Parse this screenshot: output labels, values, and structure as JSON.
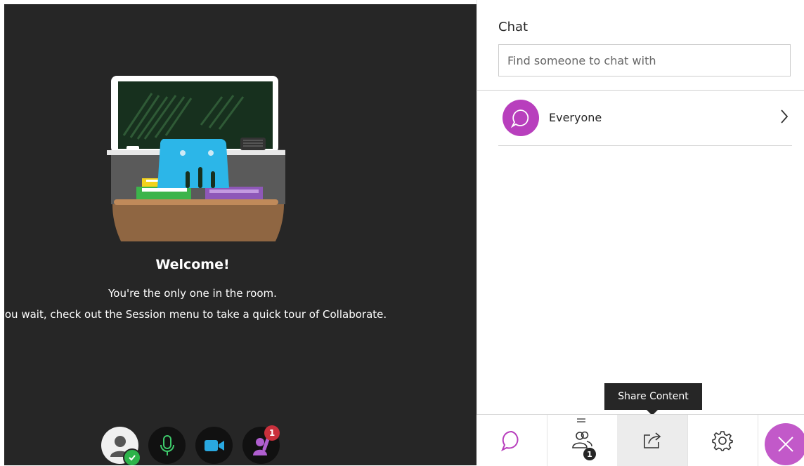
{
  "stage": {
    "welcome_title": "Welcome!",
    "welcome_line1": "You're the only one in the room.",
    "welcome_line2": "you wait, check out the Session menu to take a quick tour of Collaborate."
  },
  "controls": {
    "avatar_icon": "user-avatar-icon",
    "status_icon": "check-icon",
    "mic_icon": "microphone-icon",
    "camera_icon": "video-camera-icon",
    "hand_icon": "raise-hand-icon",
    "hand_badge": "1"
  },
  "chat_panel": {
    "title": "Chat",
    "search_placeholder": "Find someone to chat with",
    "conversations": [
      {
        "name": "Everyone",
        "icon": "chat-bubble-icon"
      }
    ]
  },
  "tooltip": {
    "text": "Share Content"
  },
  "bottom_bar": {
    "tabs": [
      {
        "name": "chat",
        "icon": "chat-bubble-icon"
      },
      {
        "name": "attendees",
        "icon": "people-icon",
        "badge": "1"
      },
      {
        "name": "share-content",
        "icon": "share-icon"
      },
      {
        "name": "settings",
        "icon": "gear-icon"
      }
    ],
    "close_icon": "close-icon"
  },
  "colors": {
    "accent": "#b83fbd",
    "stage_bg": "#262626",
    "mic_green": "#3ec96b",
    "camera_blue": "#29a8e0",
    "badge_red": "#c9303c"
  }
}
